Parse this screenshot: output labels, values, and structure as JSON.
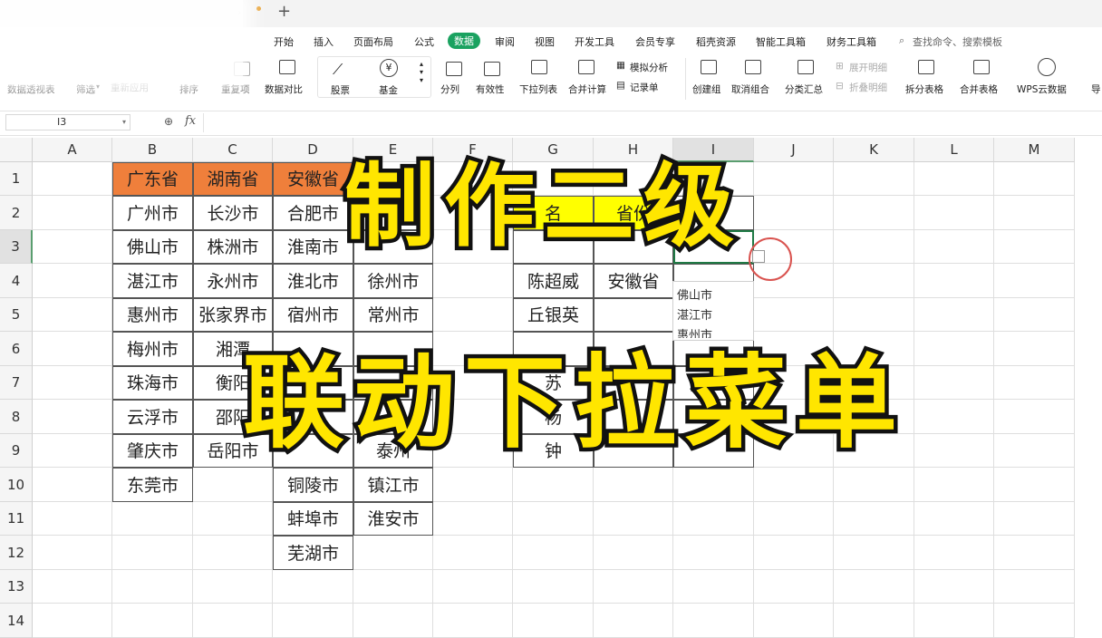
{
  "menu": [
    "开始",
    "插入",
    "页面布局",
    "公式",
    "数据",
    "审阅",
    "视图",
    "开发工具",
    "会员专享",
    "稻壳资源",
    "智能工具箱",
    "财务工具箱"
  ],
  "active_menu": "数据",
  "search_placeholder": "查找命令、搜索模板",
  "ribbon": {
    "pivot": "数据透视表",
    "filter": "筛选",
    "reapply": "重新应用",
    "sort": "排序",
    "duplicates": "重复项",
    "compare": "数据对比",
    "stocks": "股票",
    "funds": "基金",
    "split": "分列",
    "validity": "有效性",
    "dropdown_list": "下拉列表",
    "consolidate": "合并计算",
    "simulate": "模拟分析",
    "record": "记录单",
    "group": "创建组",
    "ungroup": "取消组合",
    "subtotal": "分类汇总",
    "expand": "展开明细",
    "collapse": "折叠明细",
    "split_table": "拆分表格",
    "merge_table": "合并表格",
    "wps_cloud": "WPS云数据",
    "more": "导"
  },
  "formula_bar": {
    "cell_ref": "I3",
    "zoom_icon": "magnifier-icon",
    "fx": "fx"
  },
  "columns": [
    "A",
    "B",
    "C",
    "D",
    "E",
    "F",
    "G",
    "H",
    "I",
    "J",
    "K",
    "L",
    "M"
  ],
  "rows": [
    "1",
    "2",
    "3",
    "4",
    "5",
    "6",
    "7",
    "8",
    "9",
    "10",
    "11",
    "12",
    "13",
    "14"
  ],
  "sheet": {
    "headers": [
      "广东省",
      "湖南省",
      "安徽省"
    ],
    "col_b": [
      "广州市",
      "佛山市",
      "湛江市",
      "惠州市",
      "梅州市",
      "珠海市",
      "云浮市",
      "肇庆市",
      "东莞市"
    ],
    "col_c": [
      "长沙市",
      "株洲市",
      "永州市",
      "张家界市",
      "湘潭",
      "衡阳",
      "邵阳",
      "岳阳市"
    ],
    "col_d": [
      "合肥市",
      "淮南市",
      "淮北市",
      "宿州市",
      "",
      "",
      "",
      "",
      "铜陵市",
      "蚌埠市",
      "芜湖市"
    ],
    "col_e": [
      "",
      "",
      "徐州市",
      "常州市",
      "",
      "",
      "",
      "泰州",
      "镇江市",
      "淮安市"
    ],
    "col_g": [
      "名",
      "",
      "陈超威",
      "丘银英",
      "",
      "苏",
      "杨",
      "钟"
    ],
    "col_h": [
      "省份",
      "",
      "安徽省"
    ],
    "dropdown": [
      "佛山市",
      "湛江市",
      "惠州市"
    ]
  },
  "overlay": {
    "line1": "制作二级",
    "line2": "联动下拉菜单"
  },
  "colors": {
    "accent": "#1aa260",
    "header_fill": "#ef7f3b",
    "title_yellow": "#ffe600"
  }
}
